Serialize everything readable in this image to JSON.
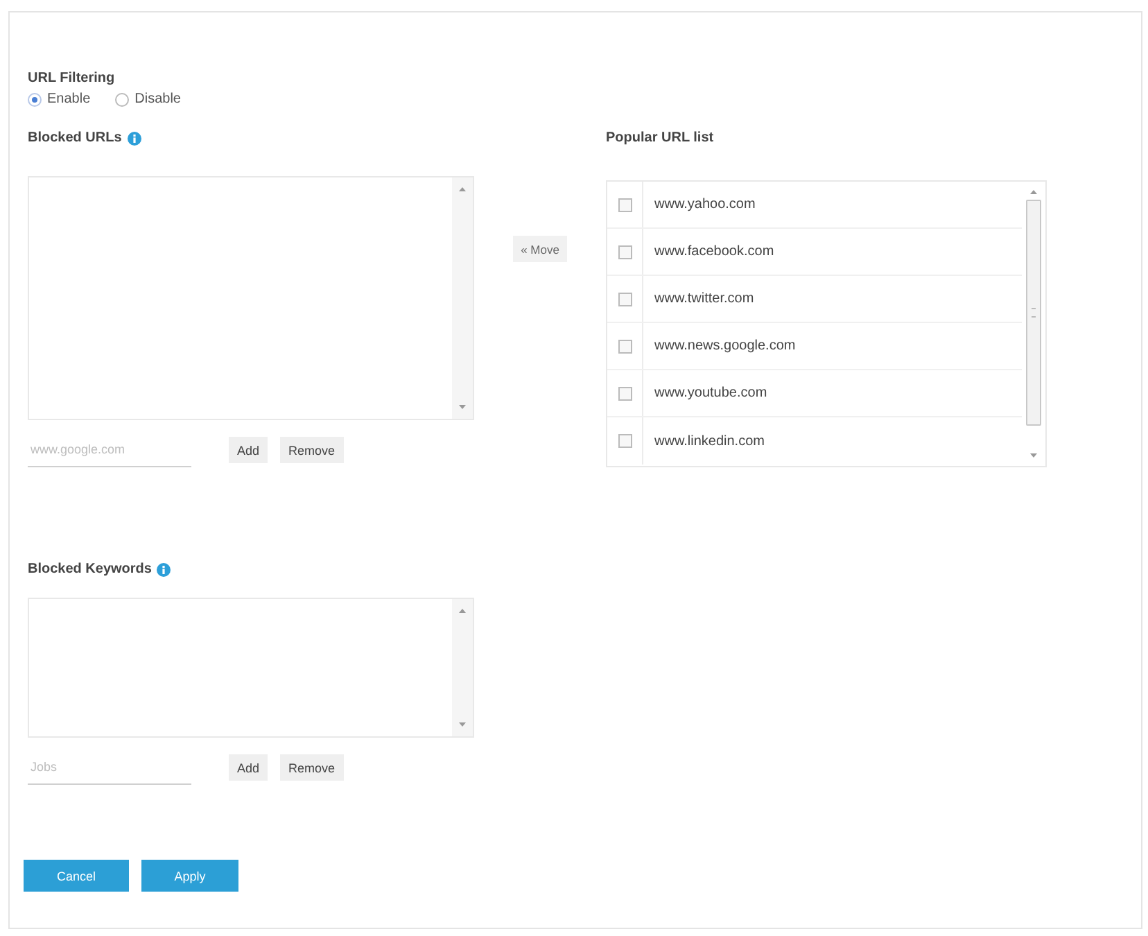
{
  "url_filtering": {
    "title": "URL Filtering",
    "options": [
      {
        "label": "Enable",
        "selected": true
      },
      {
        "label": "Disable",
        "selected": false
      }
    ]
  },
  "blocked_urls": {
    "title": "Blocked URLs",
    "input": {
      "placeholder": "www.google.com"
    },
    "buttons": [
      "Add",
      "Remove"
    ]
  },
  "move_button": "« Move",
  "popular_urls": {
    "title": "Popular URL list",
    "items": [
      {
        "label": "www.yahoo.com",
        "checked": false
      },
      {
        "label": "www.facebook.com",
        "checked": false
      },
      {
        "label": "www.twitter.com",
        "checked": false
      },
      {
        "label": "www.news.google.com",
        "checked": false
      },
      {
        "label": "www.youtube.com",
        "checked": false
      },
      {
        "label": "www.linkedin.com",
        "checked": false
      }
    ]
  },
  "blocked_keywords": {
    "title": "Blocked Keywords",
    "input": {
      "placeholder": "Jobs"
    },
    "buttons": [
      "Add",
      "Remove"
    ]
  },
  "buttons": [
    "Cancel",
    "Apply"
  ]
}
